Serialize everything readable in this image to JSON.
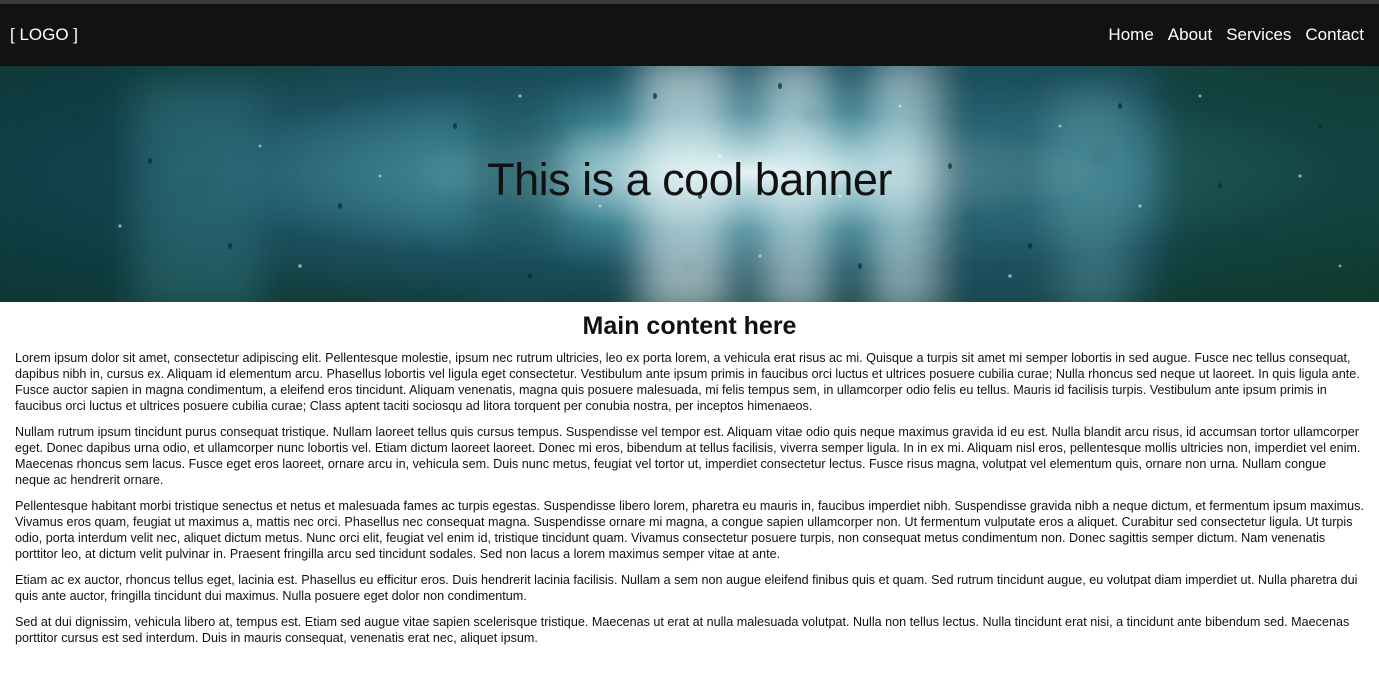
{
  "header": {
    "logo": "[ LOGO ]",
    "nav": [
      {
        "label": "Home"
      },
      {
        "label": "About"
      },
      {
        "label": "Services"
      },
      {
        "label": "Contact"
      }
    ]
  },
  "banner": {
    "title": "This is a cool banner"
  },
  "main": {
    "heading": "Main content here",
    "paragraphs": [
      "Lorem ipsum dolor sit amet, consectetur adipiscing elit. Pellentesque molestie, ipsum nec rutrum ultricies, leo ex porta lorem, a vehicula erat risus ac mi. Quisque a turpis sit amet mi semper lobortis in sed augue. Fusce nec tellus consequat, dapibus nibh in, cursus ex. Aliquam id elementum arcu. Phasellus lobortis vel ligula eget consectetur. Vestibulum ante ipsum primis in faucibus orci luctus et ultrices posuere cubilia curae; Nulla rhoncus sed neque ut laoreet. In quis ligula ante. Fusce auctor sapien in magna condimentum, a eleifend eros tincidunt. Aliquam venenatis, magna quis posuere malesuada, mi felis tempus sem, in ullamcorper odio felis eu tellus. Mauris id facilisis turpis. Vestibulum ante ipsum primis in faucibus orci luctus et ultrices posuere cubilia curae; Class aptent taciti sociosqu ad litora torquent per conubia nostra, per inceptos himenaeos.",
      "Nullam rutrum ipsum tincidunt purus consequat tristique. Nullam laoreet tellus quis cursus tempus. Suspendisse vel tempor est. Aliquam vitae odio quis neque maximus gravida id eu est. Nulla blandit arcu risus, id accumsan tortor ullamcorper eget. Donec dapibus urna odio, et ullamcorper nunc lobortis vel. Etiam dictum laoreet laoreet. Donec mi eros, bibendum at tellus facilisis, viverra semper ligula. In in ex mi. Aliquam nisl eros, pellentesque mollis ultricies non, imperdiet vel enim. Maecenas rhoncus sem lacus. Fusce eget eros laoreet, ornare arcu in, vehicula sem. Duis nunc metus, feugiat vel tortor ut, imperdiet consectetur lectus. Fusce risus magna, volutpat vel elementum quis, ornare non urna. Nullam congue neque ac hendrerit ornare.",
      "Pellentesque habitant morbi tristique senectus et netus et malesuada fames ac turpis egestas. Suspendisse libero lorem, pharetra eu mauris in, faucibus imperdiet nibh. Suspendisse gravida nibh a neque dictum, et fermentum ipsum maximus. Vivamus eros quam, feugiat ut maximus a, mattis nec orci. Phasellus nec consequat magna. Suspendisse ornare mi magna, a congue sapien ullamcorper non. Ut fermentum vulputate eros a aliquet. Curabitur sed consectetur ligula. Ut turpis odio, porta interdum velit nec, aliquet dictum metus. Nunc orci elit, feugiat vel enim id, tristique tincidunt quam. Vivamus consectetur posuere turpis, non consequat metus condimentum non. Donec sagittis semper dictum. Nam venenatis porttitor leo, at dictum velit pulvinar in. Praesent fringilla arcu sed tincidunt sodales. Sed non lacus a lorem maximus semper vitae at ante.",
      "Etiam ac ex auctor, rhoncus tellus eget, lacinia est. Phasellus eu efficitur eros. Duis hendrerit lacinia facilisis. Nullam a sem non augue eleifend finibus quis et quam. Sed rutrum tincidunt augue, eu volutpat diam imperdiet ut. Nulla pharetra dui quis ante auctor, fringilla tincidunt dui maximus. Nulla posuere eget dolor non condimentum.",
      "Sed at dui dignissim, vehicula libero at, tempus est. Etiam sed augue vitae sapien scelerisque tristique. Maecenas ut erat at nulla malesuada volutpat. Nulla non tellus lectus. Nulla tincidunt erat nisi, a tincidunt ante bibendum sed. Maecenas porttitor cursus est sed interdum. Duis in mauris consequat, venenatis erat nec, aliquet ipsum."
    ]
  }
}
